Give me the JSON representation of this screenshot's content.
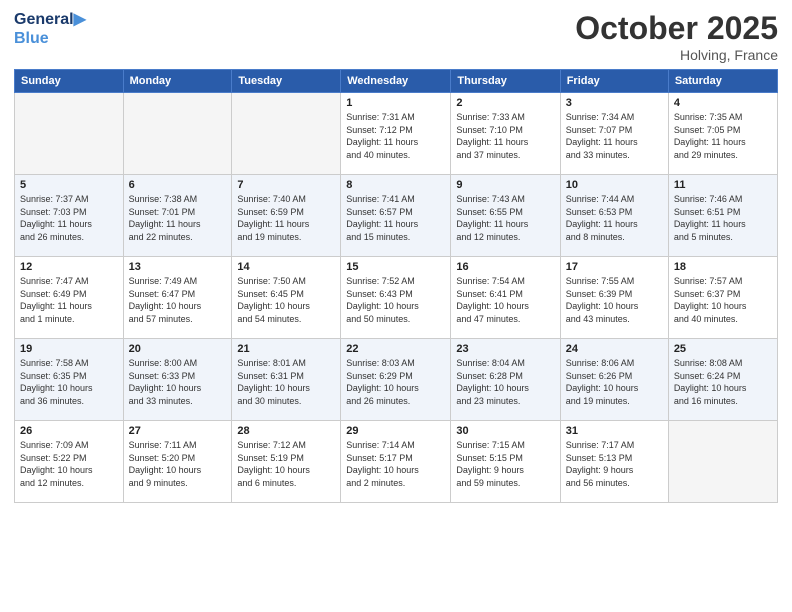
{
  "header": {
    "logo_line1": "General",
    "logo_line2": "Blue",
    "month": "October 2025",
    "location": "Holving, France"
  },
  "days_of_week": [
    "Sunday",
    "Monday",
    "Tuesday",
    "Wednesday",
    "Thursday",
    "Friday",
    "Saturday"
  ],
  "weeks": [
    [
      {
        "num": "",
        "info": ""
      },
      {
        "num": "",
        "info": ""
      },
      {
        "num": "",
        "info": ""
      },
      {
        "num": "1",
        "info": "Sunrise: 7:31 AM\nSunset: 7:12 PM\nDaylight: 11 hours\nand 40 minutes."
      },
      {
        "num": "2",
        "info": "Sunrise: 7:33 AM\nSunset: 7:10 PM\nDaylight: 11 hours\nand 37 minutes."
      },
      {
        "num": "3",
        "info": "Sunrise: 7:34 AM\nSunset: 7:07 PM\nDaylight: 11 hours\nand 33 minutes."
      },
      {
        "num": "4",
        "info": "Sunrise: 7:35 AM\nSunset: 7:05 PM\nDaylight: 11 hours\nand 29 minutes."
      }
    ],
    [
      {
        "num": "5",
        "info": "Sunrise: 7:37 AM\nSunset: 7:03 PM\nDaylight: 11 hours\nand 26 minutes."
      },
      {
        "num": "6",
        "info": "Sunrise: 7:38 AM\nSunset: 7:01 PM\nDaylight: 11 hours\nand 22 minutes."
      },
      {
        "num": "7",
        "info": "Sunrise: 7:40 AM\nSunset: 6:59 PM\nDaylight: 11 hours\nand 19 minutes."
      },
      {
        "num": "8",
        "info": "Sunrise: 7:41 AM\nSunset: 6:57 PM\nDaylight: 11 hours\nand 15 minutes."
      },
      {
        "num": "9",
        "info": "Sunrise: 7:43 AM\nSunset: 6:55 PM\nDaylight: 11 hours\nand 12 minutes."
      },
      {
        "num": "10",
        "info": "Sunrise: 7:44 AM\nSunset: 6:53 PM\nDaylight: 11 hours\nand 8 minutes."
      },
      {
        "num": "11",
        "info": "Sunrise: 7:46 AM\nSunset: 6:51 PM\nDaylight: 11 hours\nand 5 minutes."
      }
    ],
    [
      {
        "num": "12",
        "info": "Sunrise: 7:47 AM\nSunset: 6:49 PM\nDaylight: 11 hours\nand 1 minute."
      },
      {
        "num": "13",
        "info": "Sunrise: 7:49 AM\nSunset: 6:47 PM\nDaylight: 10 hours\nand 57 minutes."
      },
      {
        "num": "14",
        "info": "Sunrise: 7:50 AM\nSunset: 6:45 PM\nDaylight: 10 hours\nand 54 minutes."
      },
      {
        "num": "15",
        "info": "Sunrise: 7:52 AM\nSunset: 6:43 PM\nDaylight: 10 hours\nand 50 minutes."
      },
      {
        "num": "16",
        "info": "Sunrise: 7:54 AM\nSunset: 6:41 PM\nDaylight: 10 hours\nand 47 minutes."
      },
      {
        "num": "17",
        "info": "Sunrise: 7:55 AM\nSunset: 6:39 PM\nDaylight: 10 hours\nand 43 minutes."
      },
      {
        "num": "18",
        "info": "Sunrise: 7:57 AM\nSunset: 6:37 PM\nDaylight: 10 hours\nand 40 minutes."
      }
    ],
    [
      {
        "num": "19",
        "info": "Sunrise: 7:58 AM\nSunset: 6:35 PM\nDaylight: 10 hours\nand 36 minutes."
      },
      {
        "num": "20",
        "info": "Sunrise: 8:00 AM\nSunset: 6:33 PM\nDaylight: 10 hours\nand 33 minutes."
      },
      {
        "num": "21",
        "info": "Sunrise: 8:01 AM\nSunset: 6:31 PM\nDaylight: 10 hours\nand 30 minutes."
      },
      {
        "num": "22",
        "info": "Sunrise: 8:03 AM\nSunset: 6:29 PM\nDaylight: 10 hours\nand 26 minutes."
      },
      {
        "num": "23",
        "info": "Sunrise: 8:04 AM\nSunset: 6:28 PM\nDaylight: 10 hours\nand 23 minutes."
      },
      {
        "num": "24",
        "info": "Sunrise: 8:06 AM\nSunset: 6:26 PM\nDaylight: 10 hours\nand 19 minutes."
      },
      {
        "num": "25",
        "info": "Sunrise: 8:08 AM\nSunset: 6:24 PM\nDaylight: 10 hours\nand 16 minutes."
      }
    ],
    [
      {
        "num": "26",
        "info": "Sunrise: 7:09 AM\nSunset: 5:22 PM\nDaylight: 10 hours\nand 12 minutes."
      },
      {
        "num": "27",
        "info": "Sunrise: 7:11 AM\nSunset: 5:20 PM\nDaylight: 10 hours\nand 9 minutes."
      },
      {
        "num": "28",
        "info": "Sunrise: 7:12 AM\nSunset: 5:19 PM\nDaylight: 10 hours\nand 6 minutes."
      },
      {
        "num": "29",
        "info": "Sunrise: 7:14 AM\nSunset: 5:17 PM\nDaylight: 10 hours\nand 2 minutes."
      },
      {
        "num": "30",
        "info": "Sunrise: 7:15 AM\nSunset: 5:15 PM\nDaylight: 9 hours\nand 59 minutes."
      },
      {
        "num": "31",
        "info": "Sunrise: 7:17 AM\nSunset: 5:13 PM\nDaylight: 9 hours\nand 56 minutes."
      },
      {
        "num": "",
        "info": ""
      }
    ]
  ]
}
